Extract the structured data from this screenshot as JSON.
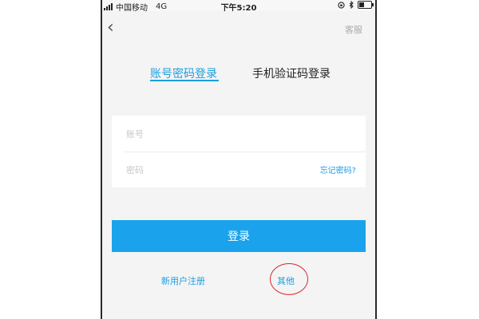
{
  "status_bar": {
    "carrier": "中国移动",
    "network": "4G",
    "time": "下午5:20",
    "icons": [
      "lock-rotation-icon",
      "bluetooth-icon",
      "battery-icon"
    ]
  },
  "nav": {
    "back_icon": "chevron-left-icon",
    "back_glyph": "‹",
    "service_label": "客服"
  },
  "tabs": [
    {
      "label": "账号密码登录",
      "active": true
    },
    {
      "label": "手机验证码登录",
      "active": false
    }
  ],
  "form": {
    "account_placeholder": "账号",
    "account_value": "",
    "password_placeholder": "密码",
    "password_value": "",
    "forgot_label": "忘记密码?"
  },
  "login_button": {
    "label": "登录"
  },
  "links": {
    "register_label": "新用户注册",
    "other_label": "其他"
  },
  "colors": {
    "accent": "#1a9ee0",
    "button": "#1aa3ec",
    "annotation": "#d8282e"
  }
}
